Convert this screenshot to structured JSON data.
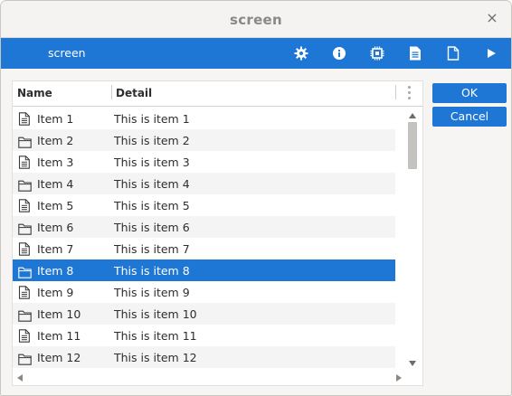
{
  "window": {
    "title": "screen",
    "close_glyph": "×"
  },
  "toolbar": {
    "title": "screen",
    "buttons": [
      {
        "name": "settings",
        "icon": "gear-icon"
      },
      {
        "name": "info",
        "icon": "info-icon"
      },
      {
        "name": "chip",
        "icon": "chip-icon"
      },
      {
        "name": "document",
        "icon": "document-icon"
      },
      {
        "name": "new-file",
        "icon": "file-icon"
      },
      {
        "name": "run",
        "icon": "play-icon"
      }
    ],
    "accent": "#1e77d4"
  },
  "list": {
    "columns": [
      "Name",
      "Detail"
    ],
    "items": [
      {
        "name": "Item 1",
        "detail": "This is item 1",
        "icon": "document-icon",
        "selected": false
      },
      {
        "name": "Item 2",
        "detail": "This is item 2",
        "icon": "folder-icon",
        "selected": false
      },
      {
        "name": "Item 3",
        "detail": "This is item 3",
        "icon": "document-icon",
        "selected": false
      },
      {
        "name": "Item 4",
        "detail": "This is item 4",
        "icon": "folder-icon",
        "selected": false
      },
      {
        "name": "Item 5",
        "detail": "This is item 5",
        "icon": "document-icon",
        "selected": false
      },
      {
        "name": "Item 6",
        "detail": "This is item 6",
        "icon": "folder-icon",
        "selected": false
      },
      {
        "name": "Item 7",
        "detail": "This is item 7",
        "icon": "document-icon",
        "selected": false
      },
      {
        "name": "Item 8",
        "detail": "This is item 8",
        "icon": "folder-icon",
        "selected": true
      },
      {
        "name": "Item 9",
        "detail": "This is item 9",
        "icon": "document-icon",
        "selected": false
      },
      {
        "name": "Item 10",
        "detail": "This is item 10",
        "icon": "folder-icon",
        "selected": false
      },
      {
        "name": "Item 11",
        "detail": "This is item 11",
        "icon": "document-icon",
        "selected": false
      },
      {
        "name": "Item 12",
        "detail": "This is item 12",
        "icon": "folder-icon",
        "selected": false
      }
    ]
  },
  "actions": {
    "ok_label": "OK",
    "cancel_label": "Cancel"
  }
}
